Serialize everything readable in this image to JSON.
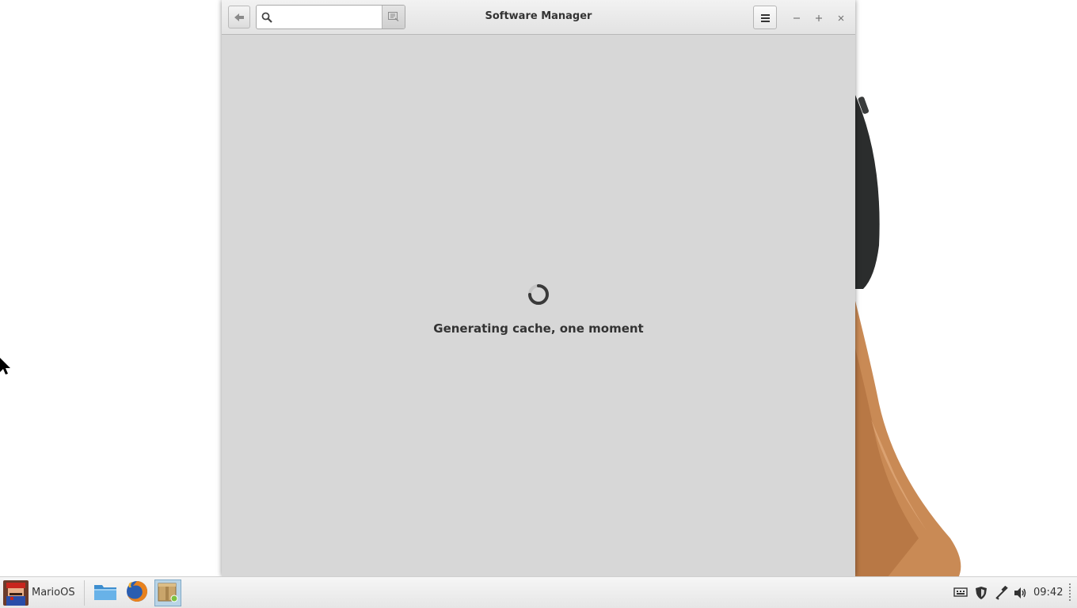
{
  "window": {
    "title": "Software Manager",
    "search": {
      "value": "",
      "placeholder": ""
    },
    "loading_message": "Generating cache, one moment"
  },
  "panel": {
    "menu_label": "MarioOS",
    "launchers": [
      "file-manager-icon",
      "firefox-icon",
      "software-manager-icon"
    ],
    "tray": [
      "keyboard-icon",
      "shield-icon",
      "network-icon",
      "volume-icon"
    ],
    "clock": "09:42"
  },
  "colors": {
    "window_bg": "#d7d7d7",
    "panel_bg": "#eeeeee",
    "active_launcher": "#b9d4e6"
  }
}
